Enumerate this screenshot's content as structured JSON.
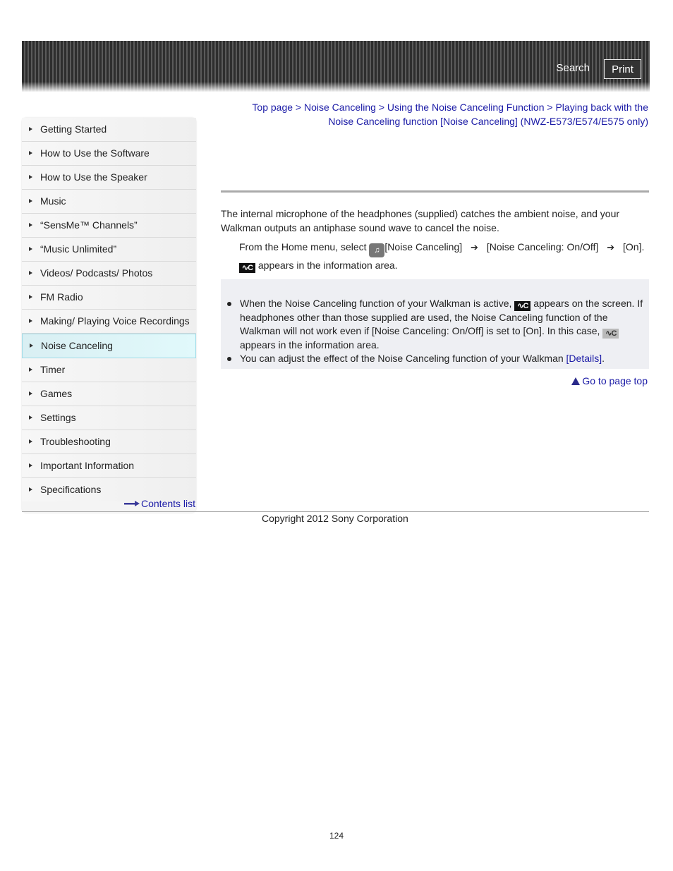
{
  "header": {
    "search_label": "Search",
    "print_label": "Print"
  },
  "sidebar": {
    "items": [
      {
        "label": "Getting Started",
        "active": false
      },
      {
        "label": "How to Use the Software",
        "active": false
      },
      {
        "label": "How to Use the Speaker",
        "active": false
      },
      {
        "label": "Music",
        "active": false
      },
      {
        "label": "“SensMe™ Channels”",
        "active": false
      },
      {
        "label": "“Music Unlimited”",
        "active": false
      },
      {
        "label": "Videos/ Podcasts/ Photos",
        "active": false
      },
      {
        "label": "FM Radio",
        "active": false
      },
      {
        "label": "Making/ Playing Voice Recordings",
        "active": false
      },
      {
        "label": "Noise Canceling",
        "active": true
      },
      {
        "label": "Timer",
        "active": false
      },
      {
        "label": "Games",
        "active": false
      },
      {
        "label": "Settings",
        "active": false
      },
      {
        "label": "Troubleshooting",
        "active": false
      },
      {
        "label": "Important Information",
        "active": false
      },
      {
        "label": "Specifications",
        "active": false
      }
    ],
    "contents_link": "Contents list"
  },
  "breadcrumb": {
    "items": [
      "Top page",
      "Noise Canceling",
      "Using the Noise Canceling Function",
      "Playing back with the Noise Canceling function [Noise Canceling] (NWZ-E573/E574/E575 only)"
    ],
    "separator": ">"
  },
  "main": {
    "intro": "The internal microphone of the headphones (supplied) catches the ambient noise, and your Walkman outputs an antiphase sound wave to cancel the noise.",
    "step": {
      "prefix": "From the Home menu, select",
      "part1": "[Noise Canceling]",
      "part2": "[Noise Canceling: On/Off]",
      "part3": "[On].",
      "result": "appears in the information area."
    },
    "notes": {
      "note1_a": "When the Noise Canceling function of your Walkman is active,",
      "note1_b": "appears on the screen. If headphones other than those supplied are used, the Noise Canceling function of the Walkman will not work even if [Noise Canceling: On/Off] is set to [On]. In this case,",
      "note1_c": "appears in the information area.",
      "note2": "You can adjust the effect of the Noise Canceling function of your Walkman",
      "note2_link": "[Details]",
      "note2_end": "."
    },
    "icons": {
      "nc_icon_text": "ᴺ\\C",
      "arrow": "➔"
    },
    "page_top_label": "Go to page top"
  },
  "footer": {
    "copyright": "Copyright 2012 Sony Corporation",
    "page_number": "124"
  }
}
